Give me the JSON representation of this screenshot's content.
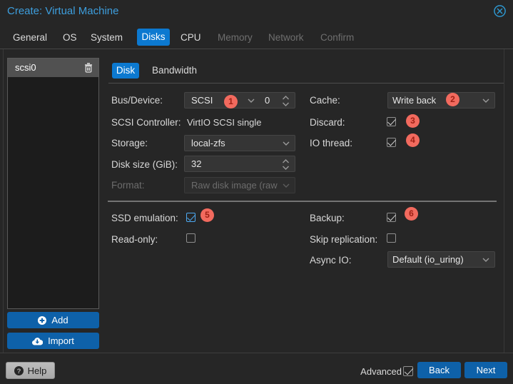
{
  "window": {
    "title": "Create: Virtual Machine",
    "close_icon": "circle-x-icon"
  },
  "tabs": [
    {
      "label": "General",
      "state": "normal"
    },
    {
      "label": "OS",
      "state": "normal"
    },
    {
      "label": "System",
      "state": "normal"
    },
    {
      "label": "Disks",
      "state": "active"
    },
    {
      "label": "CPU",
      "state": "normal"
    },
    {
      "label": "Memory",
      "state": "disabled"
    },
    {
      "label": "Network",
      "state": "disabled"
    },
    {
      "label": "Confirm",
      "state": "disabled"
    }
  ],
  "disk_list": {
    "items": [
      {
        "name": "scsi0",
        "selected": true,
        "delete_icon": "trash-icon"
      }
    ],
    "add_button": "Add",
    "import_button": "Import"
  },
  "subtabs": [
    {
      "label": "Disk",
      "state": "active"
    },
    {
      "label": "Bandwidth",
      "state": "normal"
    }
  ],
  "form": {
    "bus_device": {
      "label": "Bus/Device:",
      "value": "SCSI",
      "number": "0",
      "annotation": "1"
    },
    "scsi_controller": {
      "label": "SCSI Controller:",
      "value": "VirtIO SCSI single"
    },
    "storage": {
      "label": "Storage:",
      "value": "local-zfs"
    },
    "disk_size": {
      "label": "Disk size (GiB):",
      "value": "32"
    },
    "format": {
      "label": "Format:",
      "value": "Raw disk image (raw",
      "disabled": true
    },
    "cache": {
      "label": "Cache:",
      "value": "Write back",
      "annotation": "2"
    },
    "discard": {
      "label": "Discard:",
      "checked": true,
      "annotation": "3"
    },
    "io_thread": {
      "label": "IO thread:",
      "checked": true,
      "annotation": "4"
    },
    "ssd_emulation": {
      "label": "SSD emulation:",
      "checked": true,
      "focused": true,
      "annotation": "5"
    },
    "read_only": {
      "label": "Read-only:",
      "checked": false
    },
    "backup": {
      "label": "Backup:",
      "checked": true,
      "annotation": "6"
    },
    "skip_replication": {
      "label": "Skip replication:",
      "checked": false
    },
    "async_io": {
      "label": "Async IO:",
      "value": "Default (io_uring)"
    }
  },
  "footer": {
    "help_button": "Help",
    "advanced_label": "Advanced",
    "advanced_checked": true,
    "back_button": "Back",
    "next_button": "Next"
  },
  "colors": {
    "accent_blue": "#0c79d0",
    "button_blue": "#0e61a9",
    "title_blue": "#3d9edd",
    "annotation_red": "#f26a5e",
    "background": "#262626"
  }
}
